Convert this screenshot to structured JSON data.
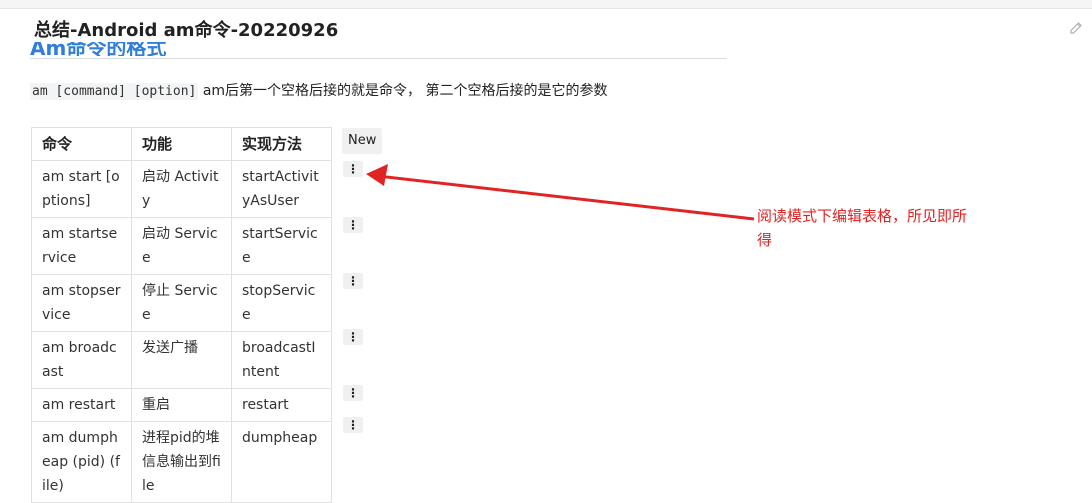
{
  "page": {
    "title": "总结-Android am命令-20220926",
    "section_heading": "Am命令的格式",
    "description": {
      "code": "am [command] [option]",
      "text": " am后第一个空格后接的就是命令， 第二个空格后接的是它的参数"
    }
  },
  "table": {
    "headers": [
      "命令",
      "功能",
      "实现方法"
    ],
    "rows": [
      [
        "am start [options]",
        "启动 Activity",
        "startActivityAsUser"
      ],
      [
        "am startservice",
        "启动 Service",
        "startService"
      ],
      [
        "am stopservice",
        "停止 Service",
        "stopService"
      ],
      [
        "am broadcast",
        "发送广播",
        "broadcastIntent"
      ],
      [
        "am restart",
        "重启",
        "restart"
      ],
      [
        "am dumpheap (pid) (file)",
        "进程pid的堆信息输出到file",
        "dumpheap"
      ]
    ]
  },
  "controls": {
    "new_label": "New",
    "row_menu_glyph": "⋮"
  },
  "annotation": {
    "text": "阅读模式下编辑表格，所见即所得",
    "color": "#e02424"
  },
  "icons": {
    "edit": "pencil-icon",
    "row_menu": "vertical-dots-icon"
  }
}
